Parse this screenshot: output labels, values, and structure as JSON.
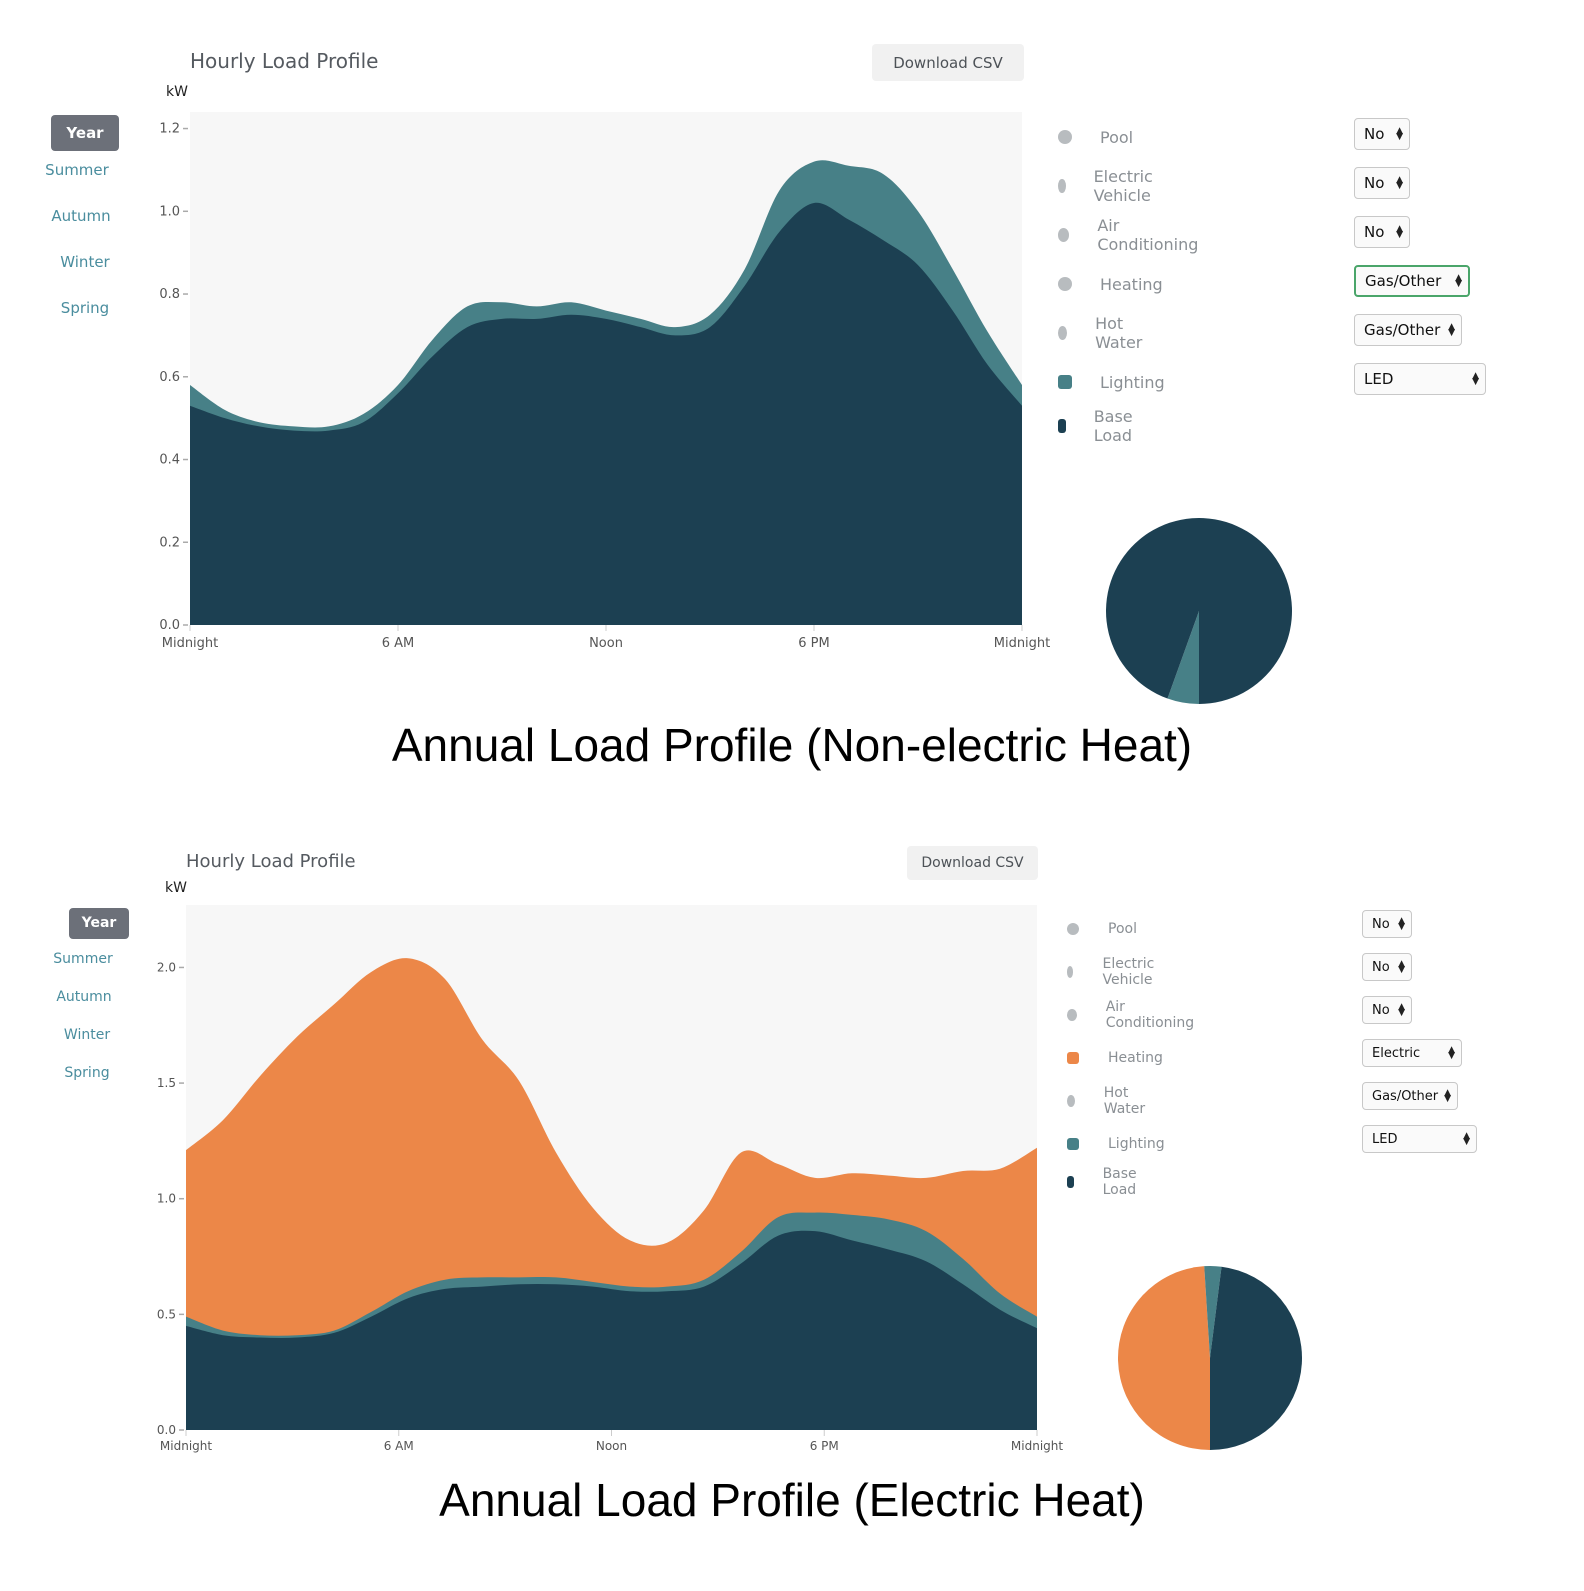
{
  "colors": {
    "base_load": "#1c4052",
    "lighting": "#478087",
    "heating": "#ec8748",
    "inactive": "#b8bcbf",
    "plot_bg": "#f7f7f7",
    "season_link": "#4a8d9e",
    "season_active_bg": "#6c7079"
  },
  "panels": [
    {
      "title": "Hourly Load Profile",
      "unit_label": "kW",
      "download_label": "Download CSV",
      "seasons": [
        {
          "label": "Year",
          "active": true
        },
        {
          "label": "Summer",
          "active": false
        },
        {
          "label": "Autumn",
          "active": false
        },
        {
          "label": "Winter",
          "active": false
        },
        {
          "label": "Spring",
          "active": false
        }
      ],
      "legend": [
        {
          "label": "Pool",
          "active": false,
          "select": "No"
        },
        {
          "label": "Electric Vehicle",
          "active": false,
          "select": "No"
        },
        {
          "label": "Air Conditioning",
          "active": false,
          "select": "No"
        },
        {
          "label": "Heating",
          "active": false,
          "select": "Gas/Other",
          "focused": true
        },
        {
          "label": "Hot Water",
          "active": false,
          "select": "Gas/Other"
        },
        {
          "label": "Lighting",
          "active": true,
          "select": "LED",
          "color_key": "lighting"
        },
        {
          "label": "Base Load",
          "active": true,
          "select": null,
          "color_key": "base_load"
        }
      ],
      "caption": "Annual Load Profile (Non-electric Heat)"
    },
    {
      "title": "Hourly Load Profile",
      "unit_label": "kW",
      "download_label": "Download CSV",
      "seasons": [
        {
          "label": "Year",
          "active": true
        },
        {
          "label": "Summer",
          "active": false
        },
        {
          "label": "Autumn",
          "active": false
        },
        {
          "label": "Winter",
          "active": false
        },
        {
          "label": "Spring",
          "active": false
        }
      ],
      "legend": [
        {
          "label": "Pool",
          "active": false,
          "select": "No"
        },
        {
          "label": "Electric Vehicle",
          "active": false,
          "select": "No"
        },
        {
          "label": "Air Conditioning",
          "active": false,
          "select": "No"
        },
        {
          "label": "Heating",
          "active": true,
          "select": "Electric",
          "color_key": "heating"
        },
        {
          "label": "Hot Water",
          "active": false,
          "select": "Gas/Other"
        },
        {
          "label": "Lighting",
          "active": true,
          "select": "LED",
          "color_key": "lighting"
        },
        {
          "label": "Base Load",
          "active": true,
          "select": null,
          "color_key": "base_load"
        }
      ],
      "caption": "Annual Load Profile (Electric Heat)"
    }
  ],
  "chart_data": [
    {
      "type": "area",
      "stacked": true,
      "title": "Hourly Load Profile",
      "subtitle": "Annual Load Profile (Non-electric Heat)",
      "xlabel": "",
      "ylabel": "kW",
      "x": [
        0,
        1,
        2,
        3,
        4,
        5,
        6,
        7,
        8,
        9,
        10,
        11,
        12,
        13,
        14,
        15,
        16,
        17,
        18,
        19,
        20,
        21,
        22,
        23,
        24
      ],
      "x_ticks": [
        {
          "value": 0,
          "label": "Midnight"
        },
        {
          "value": 6,
          "label": "6 AM"
        },
        {
          "value": 12,
          "label": "Noon"
        },
        {
          "value": 18,
          "label": "6 PM"
        },
        {
          "value": 24,
          "label": "Midnight"
        }
      ],
      "y_ticks": [
        {
          "value": 0.0,
          "label": "0.0"
        },
        {
          "value": 0.2,
          "label": "0.2"
        },
        {
          "value": 0.4,
          "label": "0.4"
        },
        {
          "value": 0.6,
          "label": "0.6"
        },
        {
          "value": 0.8,
          "label": "0.8"
        },
        {
          "value": 1.0,
          "label": "1.0"
        },
        {
          "value": 1.2,
          "label": "1.2"
        }
      ],
      "xlim": [
        0,
        24
      ],
      "ylim": [
        0,
        1.24
      ],
      "grid": false,
      "series": [
        {
          "name": "Base Load",
          "color_key": "base_load",
          "values": [
            0.53,
            0.5,
            0.48,
            0.47,
            0.47,
            0.49,
            0.56,
            0.65,
            0.72,
            0.74,
            0.74,
            0.75,
            0.74,
            0.72,
            0.7,
            0.72,
            0.82,
            0.95,
            1.02,
            0.98,
            0.93,
            0.87,
            0.76,
            0.63,
            0.53
          ]
        },
        {
          "name": "Lighting",
          "color_key": "lighting",
          "values": [
            0.05,
            0.02,
            0.01,
            0.01,
            0.01,
            0.02,
            0.02,
            0.04,
            0.05,
            0.04,
            0.03,
            0.03,
            0.02,
            0.02,
            0.02,
            0.03,
            0.04,
            0.1,
            0.1,
            0.13,
            0.16,
            0.13,
            0.1,
            0.08,
            0.05
          ]
        }
      ],
      "pie": [
        {
          "name": "Base Load",
          "color_key": "base_load",
          "share": 0.945
        },
        {
          "name": "Lighting",
          "color_key": "lighting",
          "share": 0.055
        }
      ]
    },
    {
      "type": "area",
      "stacked": true,
      "title": "Hourly Load Profile",
      "subtitle": "Annual Load Profile (Electric Heat)",
      "xlabel": "",
      "ylabel": "kW",
      "x": [
        0,
        1,
        2,
        3,
        4,
        5,
        6,
        7,
        8,
        9,
        10,
        11,
        12,
        13,
        14,
        15,
        16,
        17,
        18,
        19,
        20,
        21,
        22,
        23,
        24
      ],
      "x_ticks": [
        {
          "value": 0,
          "label": "Midnight"
        },
        {
          "value": 6,
          "label": "6 AM"
        },
        {
          "value": 12,
          "label": "Noon"
        },
        {
          "value": 18,
          "label": "6 PM"
        },
        {
          "value": 24,
          "label": "Midnight"
        }
      ],
      "y_ticks": [
        {
          "value": 0.0,
          "label": "0.0"
        },
        {
          "value": 0.5,
          "label": "0.5"
        },
        {
          "value": 1.0,
          "label": "1.0"
        },
        {
          "value": 1.5,
          "label": "1.5"
        },
        {
          "value": 2.0,
          "label": "2.0"
        }
      ],
      "xlim": [
        0,
        24
      ],
      "ylim": [
        0,
        2.27
      ],
      "grid": false,
      "series": [
        {
          "name": "Base Load",
          "color_key": "base_load",
          "values": [
            0.45,
            0.41,
            0.4,
            0.4,
            0.42,
            0.49,
            0.57,
            0.61,
            0.62,
            0.63,
            0.63,
            0.62,
            0.6,
            0.6,
            0.62,
            0.72,
            0.84,
            0.86,
            0.82,
            0.78,
            0.73,
            0.63,
            0.52,
            0.44
          ]
        },
        {
          "name": "Lighting",
          "color_key": "lighting",
          "values": [
            0.04,
            0.02,
            0.01,
            0.01,
            0.01,
            0.02,
            0.03,
            0.04,
            0.04,
            0.03,
            0.03,
            0.02,
            0.02,
            0.02,
            0.03,
            0.05,
            0.08,
            0.08,
            0.11,
            0.13,
            0.13,
            0.11,
            0.07,
            0.05
          ]
        },
        {
          "name": "Heating",
          "color_key": "heating",
          "values": [
            0.72,
            0.91,
            1.12,
            1.29,
            1.41,
            1.47,
            1.44,
            1.3,
            1.03,
            0.85,
            0.54,
            0.32,
            0.2,
            0.19,
            0.3,
            0.43,
            0.23,
            0.15,
            0.18,
            0.19,
            0.23,
            0.38,
            0.54,
            0.73
          ]
        }
      ],
      "pie": [
        {
          "name": "Heating",
          "color_key": "heating",
          "share": 0.49
        },
        {
          "name": "Lighting",
          "color_key": "lighting",
          "share": 0.03
        },
        {
          "name": "Base Load",
          "color_key": "base_load",
          "share": 0.48
        }
      ]
    }
  ]
}
